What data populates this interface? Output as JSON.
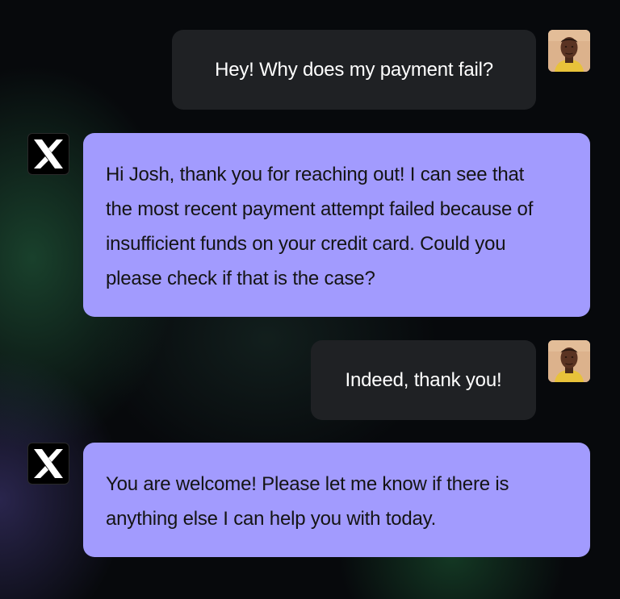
{
  "messages": [
    {
      "sender": "user",
      "avatar_icon": "user-avatar-photo",
      "lines": [
        "Hey! Why does my payment fail?"
      ]
    },
    {
      "sender": "bot",
      "avatar_icon": "x-logo-icon",
      "lines": [
        "Hi Josh, thank you for reaching out! I can see that",
        "the most recent payment attempt failed because of",
        "insufficient funds on your credit card. Could you",
        "please check if that is the case?"
      ]
    },
    {
      "sender": "user",
      "avatar_icon": "user-avatar-photo",
      "lines": [
        "Indeed, thank you!"
      ]
    },
    {
      "sender": "bot",
      "avatar_icon": "x-logo-icon",
      "lines": [
        "You are welcome! Please let me know if there is",
        "anything else I can help you with today."
      ]
    }
  ],
  "colors": {
    "user_bubble": "#1f2124",
    "bot_bubble": "#a29bfe",
    "user_text": "#ffffff",
    "bot_text": "#141414",
    "background": "#07090c"
  }
}
